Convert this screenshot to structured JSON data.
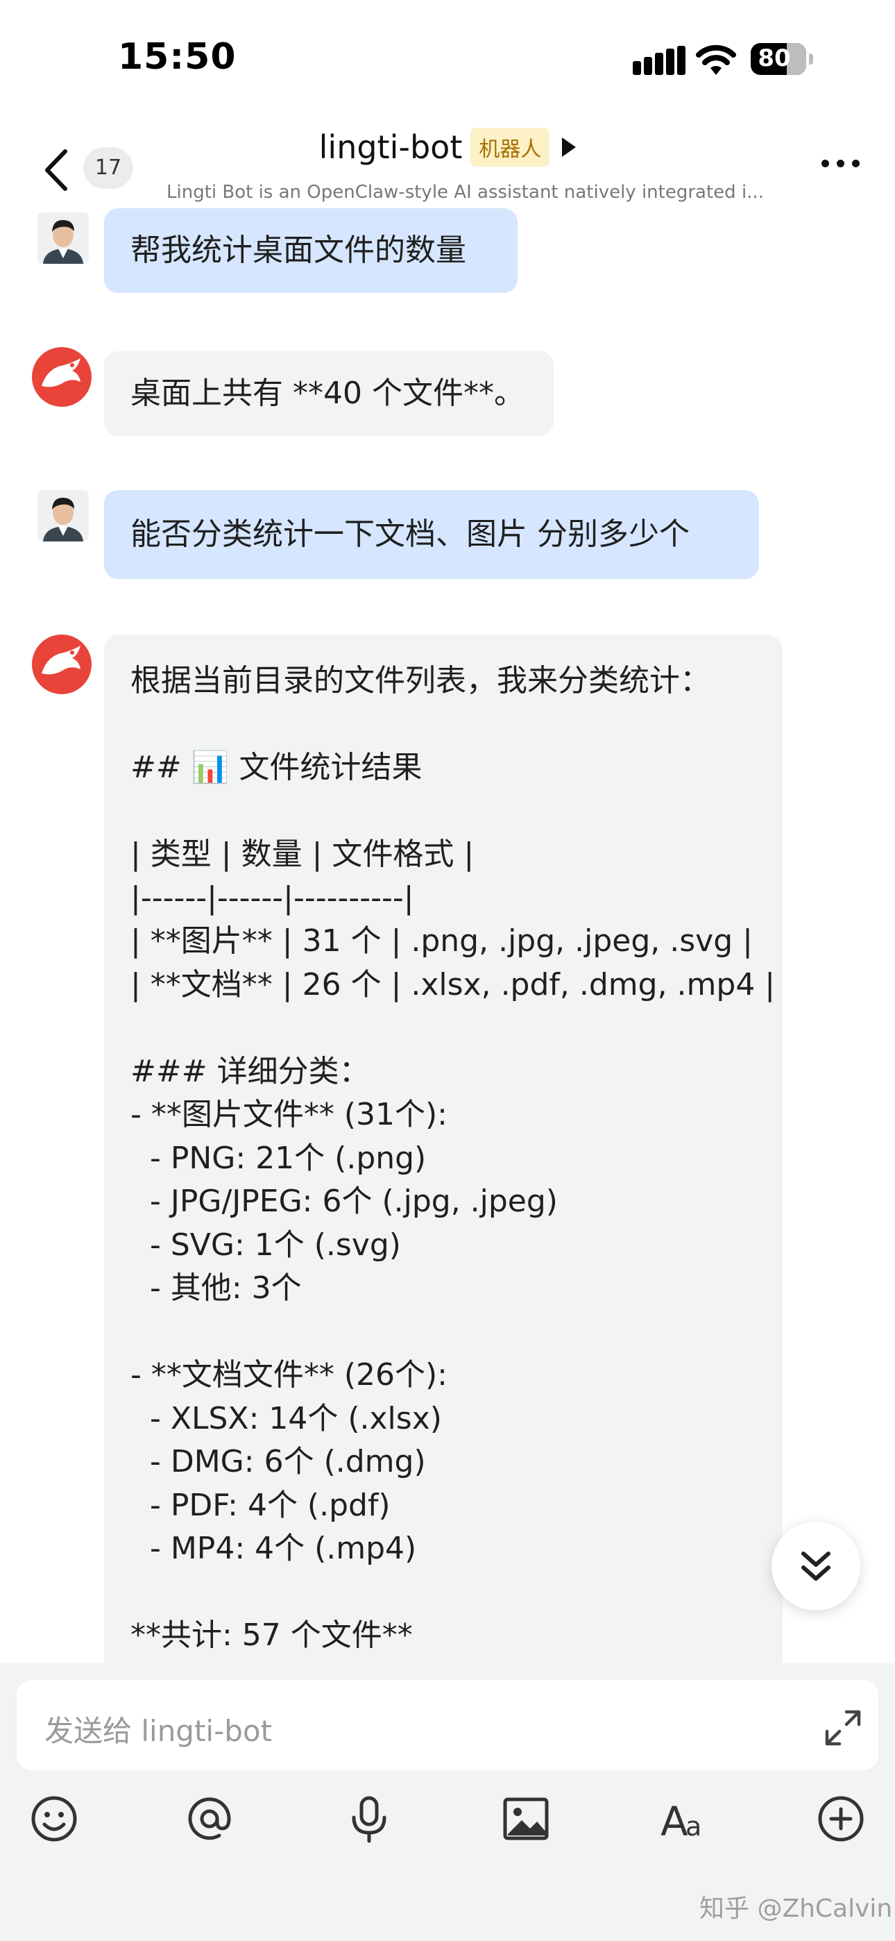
{
  "status_bar": {
    "time": "15:50",
    "battery": "80"
  },
  "header": {
    "unread_count": "17",
    "title": "lingti-bot",
    "tag": "机器人",
    "subtitle": "Lingti Bot is an OpenClaw-style AI assistant natively integrated i..."
  },
  "messages": [
    {
      "sender": "user",
      "text": "帮我统计桌面文件的数量"
    },
    {
      "sender": "bot",
      "text": "桌面上共有 **40 个文件**。"
    },
    {
      "sender": "user",
      "text": "能否分类统计一下文档、图片 分别多少个"
    },
    {
      "sender": "bot",
      "lines": [
        "根据当前目录的文件列表，我来分类统计：",
        "",
        "## 📊 文件统计结果",
        "",
        "| 类型 | 数量 | 文件格式 |",
        "|------|------|----------|",
        "| **图片** | 31 个 | .png, .jpg, .jpeg, .svg |",
        "| **文档** | 26 个 | .xlsx, .pdf, .dmg, .mp4 |",
        "",
        "### 详细分类：",
        "- **图片文件** (31个):",
        "  - PNG: 21个 (.png)",
        "  - JPG/JPEG: 6个 (.jpg, .jpeg)",
        "  - SVG: 1个 (.svg)",
        "  - 其他: 3个",
        "",
        "- **文档文件** (26个):",
        "  - XLSX: 14个 (.xlsx)",
        "  - DMG: 6个 (.dmg)",
        "  - PDF: 4个 (.pdf)",
        "  - MP4: 4个 (.mp4)",
        "",
        "**共计: 57 个文件**"
      ]
    }
  ],
  "composer": {
    "placeholder": "发送给 lingti-bot",
    "toolbar": [
      "emoji-icon",
      "mention-icon",
      "microphone-icon",
      "image-icon",
      "font-icon",
      "plus-icon"
    ]
  },
  "watermark": "知乎 @ZhCalvin",
  "colors": {
    "user_bubble": "#d5e6fe",
    "bot_bubble": "#f2f3f5",
    "tag_bg": "#fcf0c7",
    "tag_text": "#a87100",
    "bot_avatar": "#e8443a"
  }
}
